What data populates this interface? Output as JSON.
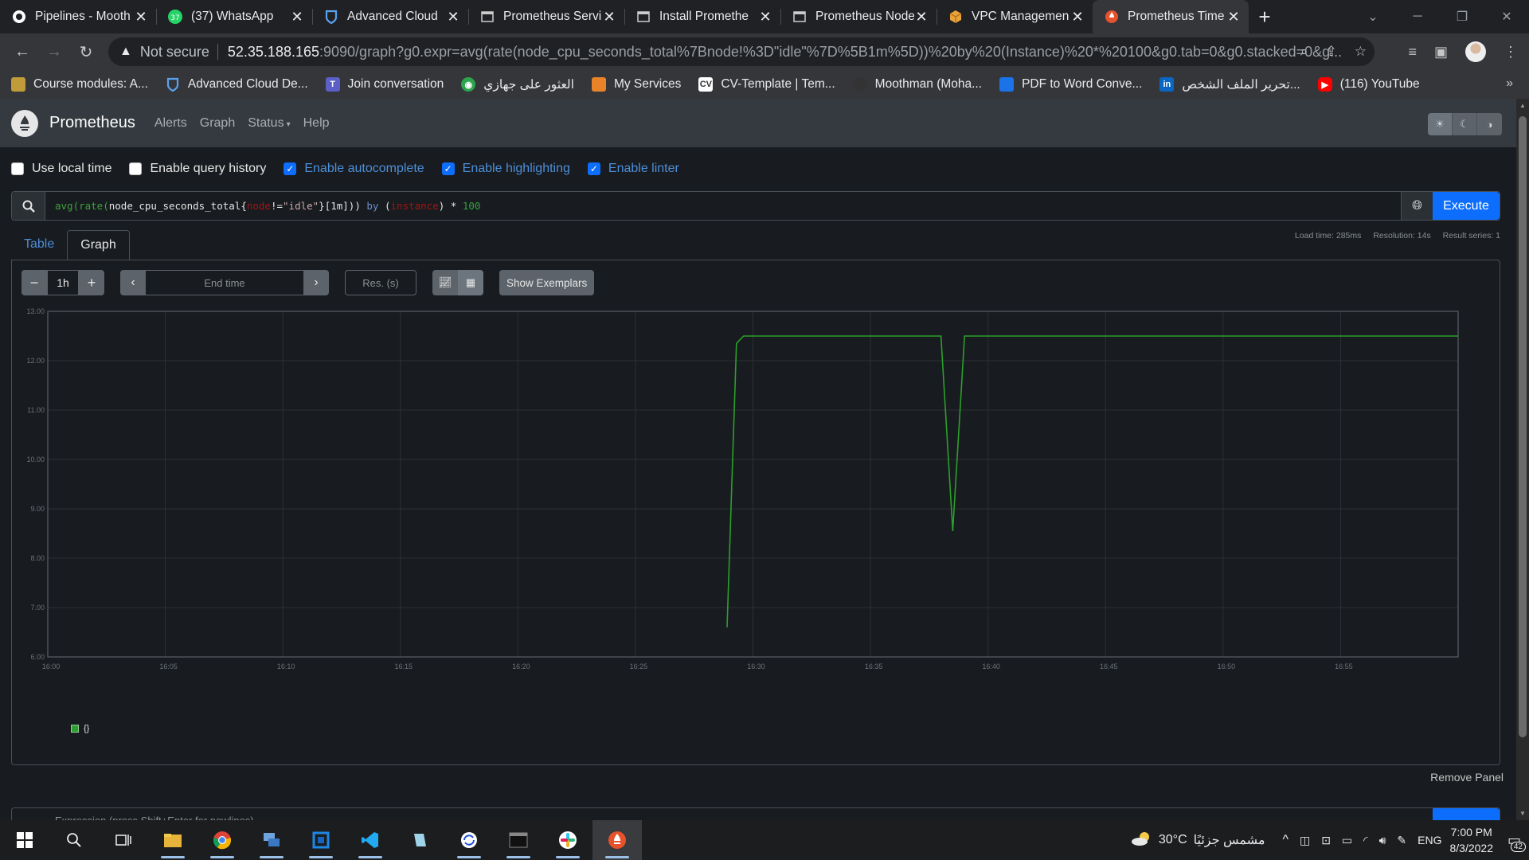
{
  "browser": {
    "tabs": [
      {
        "title": "Pipelines - Mooth",
        "icon": "github-icon"
      },
      {
        "title": "(37) WhatsApp",
        "icon": "whatsapp-icon",
        "badge": "37"
      },
      {
        "title": "Advanced Cloud",
        "icon": "shield-icon"
      },
      {
        "title": "Prometheus Servi",
        "icon": "page-icon"
      },
      {
        "title": "Install Promethe",
        "icon": "page-icon"
      },
      {
        "title": "Prometheus Node",
        "icon": "page-icon"
      },
      {
        "title": "VPC Managemen",
        "icon": "aws-box-icon"
      },
      {
        "title": "Prometheus Time",
        "icon": "prometheus-icon",
        "active": true
      }
    ],
    "address": {
      "warning": "Not secure",
      "host": "52.35.188.165",
      "path": ":9090/graph?g0.expr=avg(rate(node_cpu_seconds_total%7Bnode!%3D\"idle\"%7D%5B1m%5D))%20by%20(Instance)%20*%20100&g0.tab=0&g0.stacked=0&g..."
    },
    "bookmarks": [
      {
        "label": "Course modules: A...",
        "icon": "course-icon",
        "color": "#c09b3a"
      },
      {
        "label": "Advanced Cloud De...",
        "icon": "shield-icon",
        "color": "#3a86d4"
      },
      {
        "label": "Join conversation",
        "icon": "teams-icon",
        "color": "#5b5fc7"
      },
      {
        "label": "العثور على جهازي",
        "icon": "find-device-icon",
        "color": "#2da44e"
      },
      {
        "label": "My Services",
        "icon": "aws-box-icon",
        "color": "#e8832a"
      },
      {
        "label": "CV-Template | Tem...",
        "icon": "cv-icon",
        "color": "#ffffff"
      },
      {
        "label": "Moothman (Moha...",
        "icon": "github-icon",
        "color": "#333333"
      },
      {
        "label": "PDF to Word Conve...",
        "icon": "pdf-icon",
        "color": "#1a73e8"
      },
      {
        "label": "تحرير الملف الشخص...",
        "icon": "linkedin-icon",
        "color": "#0a66c2"
      },
      {
        "label": "(116) YouTube",
        "icon": "youtube-icon",
        "color": "#ff0000"
      }
    ]
  },
  "prometheus": {
    "brand": "Prometheus",
    "nav": [
      "Alerts",
      "Graph",
      "Status",
      "Help"
    ],
    "options": [
      {
        "label": "Use local time",
        "checked": false
      },
      {
        "label": "Enable query history",
        "checked": false
      },
      {
        "label": "Enable autocomplete",
        "checked": true
      },
      {
        "label": "Enable highlighting",
        "checked": true
      },
      {
        "label": "Enable linter",
        "checked": true
      }
    ],
    "expression": {
      "fn1": "avg(",
      "fn2": "rate(",
      "metric": "node_cpu_seconds_total{",
      "label": "node",
      "op": "!=",
      "str": "\"idle\"",
      "close": "}[1m])) ",
      "by": "by",
      "paren_open": " (",
      "group": "instance",
      "paren_close": ") ",
      "mult": "* ",
      "num": "100"
    },
    "execute_label": "Execute",
    "tabs": [
      "Table",
      "Graph"
    ],
    "stats": {
      "load": "Load time: 285ms",
      "resolution": "Resolution: 14s",
      "series": "Result series: 1"
    },
    "controls": {
      "range": "1h",
      "end_placeholder": "End time",
      "res_placeholder": "Res. (s)",
      "exemplars": "Show Exemplars"
    },
    "remove_panel": "Remove Panel",
    "next_placeholder": "Expression (press Shift+Enter for newlines)",
    "legend": "{}"
  },
  "chart_data": {
    "type": "line",
    "x_ticks": [
      "16:00",
      "16:05",
      "16:10",
      "16:15",
      "16:20",
      "16:25",
      "16:30",
      "16:35",
      "16:40",
      "16:45",
      "16:50",
      "16:55"
    ],
    "y_ticks": [
      "6.00",
      "7.00",
      "8.00",
      "9.00",
      "10.00",
      "11.00",
      "12.00",
      "13.00"
    ],
    "ylim": [
      6,
      13
    ],
    "xlim_minutes": [
      0,
      60
    ],
    "series": [
      {
        "name": "{}",
        "color": "#2ca02c",
        "points": [
          [
            28.9,
            6.6
          ],
          [
            29.3,
            12.35
          ],
          [
            29.6,
            12.5
          ],
          [
            38.0,
            12.5
          ],
          [
            38.5,
            8.55
          ],
          [
            39.0,
            12.5
          ],
          [
            60.0,
            12.5
          ]
        ]
      }
    ]
  },
  "taskbar": {
    "weather": "30°C",
    "weather_text": "مشمس جزئيًا",
    "lang": "ENG",
    "time": "7:00 PM",
    "date": "8/3/2022",
    "notifications": "42"
  }
}
